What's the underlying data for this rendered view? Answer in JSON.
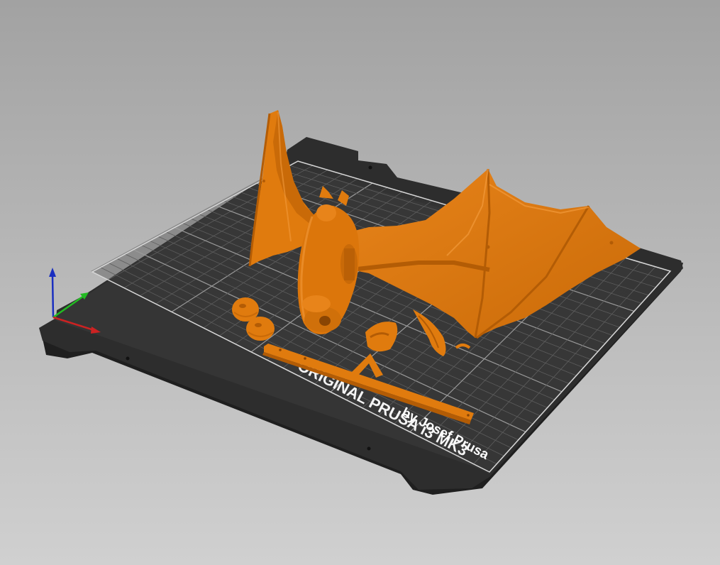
{
  "app": {
    "view": "3d-plater"
  },
  "bed": {
    "label_line1": "ORIGINAL PRUSA i3 MK3",
    "label_line2": "by Josef Prusa",
    "colors": {
      "background_top": "#a3a3a3",
      "background_bottom": "#cfcfcf",
      "bed_frame": "#2b2b2b",
      "bed_surface": "#404040",
      "grid_line": "#6c6c6c",
      "grid_border": "#e6e6e6"
    }
  },
  "model": {
    "name_icon": "bat-dragon-model",
    "color": "#e07b0e",
    "shade_color": "#b35c05",
    "highlight_color": "#f29a3a"
  },
  "axes": {
    "x_color": "#cc2222",
    "y_color": "#22bb22",
    "z_color": "#1a2fc0"
  }
}
